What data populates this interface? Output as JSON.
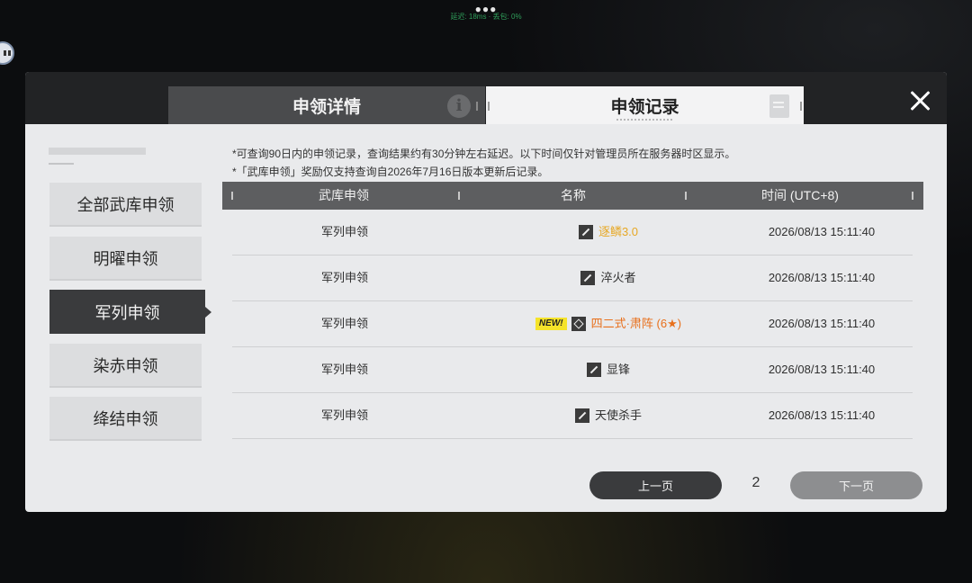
{
  "status": {
    "text": "延迟: 18ms · 丢包: 0%",
    "dots": "●●●"
  },
  "tabs": [
    {
      "label": "申领详情",
      "icon": "info-icon",
      "active": false
    },
    {
      "label": "申领记录",
      "icon": "document-icon",
      "active": true
    }
  ],
  "sidebar": {
    "items": [
      {
        "label": "全部武库申领",
        "active": false
      },
      {
        "label": "明曜申领",
        "active": false
      },
      {
        "label": "军列申领",
        "active": true
      },
      {
        "label": "染赤申领",
        "active": false
      },
      {
        "label": "绛结申领",
        "active": false
      }
    ]
  },
  "notes": [
    "*可查询90日内的申领记录，查询结果约有30分钟左右延迟。以下时间仅针对管理员所在服务器时区显示。",
    "*「武库申领」奖励仅支持查询自2026年7月16日版本更新后记录。"
  ],
  "table": {
    "columns": [
      "武库申领",
      "名称",
      "时间 (UTC+8)"
    ],
    "rows": [
      {
        "type": "军列申领",
        "name": "逐鳞3.0",
        "color": "#e7a825",
        "badge": "",
        "icon": "weapon-icon",
        "time": "2026/08/13 15:11:40"
      },
      {
        "type": "军列申领",
        "name": "淬火者",
        "color": "#2f2f2f",
        "badge": "",
        "icon": "weapon-icon",
        "time": "2026/08/13 15:11:40"
      },
      {
        "type": "军列申领",
        "name": "四二式·肃阵 (6★)",
        "color": "#e8701c",
        "badge": "NEW!",
        "icon": "operator-icon",
        "time": "2026/08/13 15:11:40"
      },
      {
        "type": "军列申领",
        "name": "显锋",
        "color": "#2f2f2f",
        "badge": "",
        "icon": "weapon-icon",
        "time": "2026/08/13 15:11:40"
      },
      {
        "type": "军列申领",
        "name": "天使杀手",
        "color": "#2f2f2f",
        "badge": "",
        "icon": "weapon-icon",
        "time": "2026/08/13 15:11:40"
      }
    ]
  },
  "pagination": {
    "prev_label": "上一页",
    "page": "2",
    "next_label": "下一页"
  }
}
